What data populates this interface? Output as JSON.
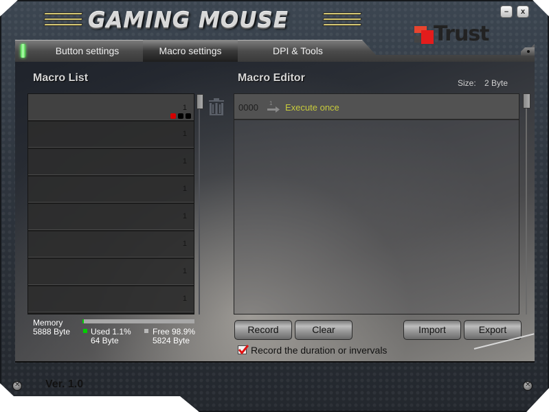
{
  "app": {
    "title": "GAMING MOUSE",
    "brand": "Trust",
    "version": "Ver.  1.0"
  },
  "window_controls": {
    "minimize_label": "–",
    "close_label": "x"
  },
  "tabs": [
    {
      "label": "Button settings",
      "active": false
    },
    {
      "label": "Macro settings",
      "active": true
    },
    {
      "label": "DPI & Tools",
      "active": false
    }
  ],
  "macro_list": {
    "title": "Macro List",
    "items": [
      {
        "number": "1",
        "selected": true
      },
      {
        "number": "1",
        "selected": false
      },
      {
        "number": "1",
        "selected": false
      },
      {
        "number": "1",
        "selected": false
      },
      {
        "number": "1",
        "selected": false
      },
      {
        "number": "1",
        "selected": false
      },
      {
        "number": "1",
        "selected": false
      },
      {
        "number": "1",
        "selected": false
      }
    ],
    "selected_indicators": [
      "#d40000",
      "#000000",
      "#000000"
    ]
  },
  "macro_editor": {
    "title": "Macro Editor",
    "size_label": "Size:",
    "size_value": "2 Byte",
    "rows": [
      {
        "address": "0000",
        "icon": "execute-once-arrow-icon",
        "command": "Execute once"
      }
    ]
  },
  "memory": {
    "label": "Memory",
    "total": "5888 Byte",
    "used_label": "Used 1.1%",
    "used_bytes": "64 Byte",
    "free_label": "Free 98.9%",
    "free_bytes": "5824 Byte",
    "used_percent": 1.1,
    "used_color": "#00d000",
    "free_color": "#a8a8a8"
  },
  "buttons": {
    "record": "Record",
    "clear": "Clear",
    "import": "Import",
    "export": "Export"
  },
  "record_option": {
    "label": "Record the duration or invervals",
    "checked": true,
    "check_color": "#e01010"
  },
  "colors": {
    "accent_command": "#c8cb3c",
    "tab_led": "#4fd64f"
  }
}
